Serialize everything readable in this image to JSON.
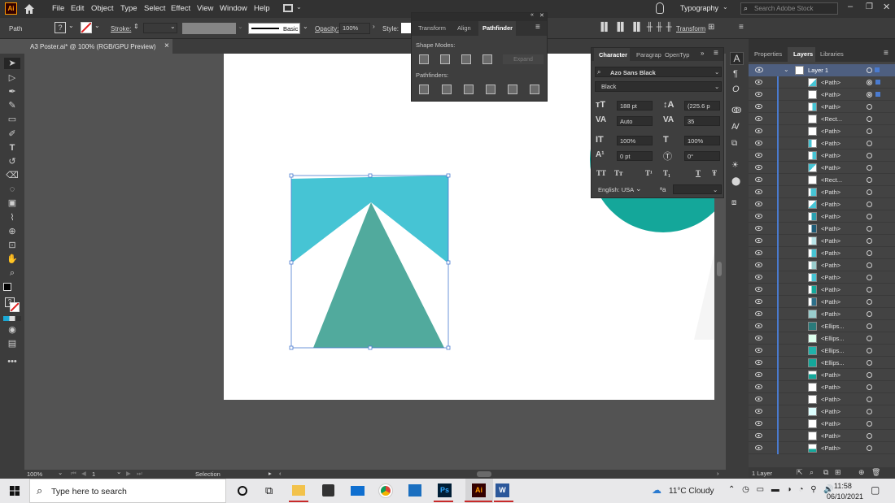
{
  "app": {
    "logo": "Ai",
    "accent": "#ff9a00"
  },
  "menu": [
    "File",
    "Edit",
    "Object",
    "Type",
    "Select",
    "Effect",
    "View",
    "Window",
    "Help"
  ],
  "workspace_name": "Typography",
  "search": {
    "placeholder": "Search Adobe Stock"
  },
  "control": {
    "object_type": "Path",
    "stroke_label": "Stroke:",
    "brush_label": "Basic",
    "opacity_label": "Opacity:",
    "opacity_value": "100%",
    "style_label": "Style:",
    "transform_label": "Transform"
  },
  "document_tab": {
    "title": "A3 Poster.ai* @ 100% (RGB/GPU Preview)",
    "close": "×"
  },
  "pathfinder": {
    "tabs": [
      "Transform",
      "Align",
      "Pathfinder"
    ],
    "shape_modes_label": "Shape Modes:",
    "expand_label": "Expand",
    "pathfinders_label": "Pathfinders:"
  },
  "character": {
    "tabs": [
      "Character",
      "Paragrap",
      "OpenTyp"
    ],
    "font_family": "Azo Sans Black",
    "font_style": "Black",
    "font_size": "188 pt",
    "leading": "(225.6 p",
    "kerning": "Auto",
    "tracking": "35",
    "vscale": "100%",
    "hscale": "100%",
    "baseline": "0 pt",
    "rotation": "0°",
    "language": "English: USA",
    "aa_label": "ªa",
    "style_buttons": [
      "TT",
      "Tт",
      "T¹",
      "T₁",
      "T",
      "Ŧ"
    ]
  },
  "layers_panel": {
    "tabs": [
      "Properties",
      "Layers",
      "Libraries"
    ],
    "layer_name": "Layer 1",
    "items": [
      "<Path>",
      "<Path>",
      "<Path>",
      "<Rect...",
      "<Path>",
      "<Path>",
      "<Path>",
      "<Path>",
      "<Rect...",
      "<Path>",
      "<Path>",
      "<Path>",
      "<Path>",
      "<Path>",
      "<Path>",
      "<Path>",
      "<Path>",
      "<Path>",
      "<Path>",
      "<Path>",
      "<Ellips...",
      "<Ellips...",
      "<Ellips...",
      "<Ellips...",
      "<Path>",
      "<Path>",
      "<Path>",
      "<Path>",
      "<Path>",
      "<Path>",
      "<Path>"
    ],
    "footer": "1 Layer"
  },
  "status": {
    "zoom": "100%",
    "artboard": "1",
    "mode": "Selection"
  },
  "taskbar": {
    "search_placeholder": "Type here to search",
    "weather": "11°C  Cloudy",
    "time": "11:58",
    "date": "06/10/2021",
    "apps": [
      "Ps",
      "Ai",
      "W"
    ]
  },
  "colors": {
    "top_shape": "#46c4d4",
    "triangle": "#51aa9d",
    "teal_circle": "#14a79a",
    "selection": "#4a7bd0"
  }
}
